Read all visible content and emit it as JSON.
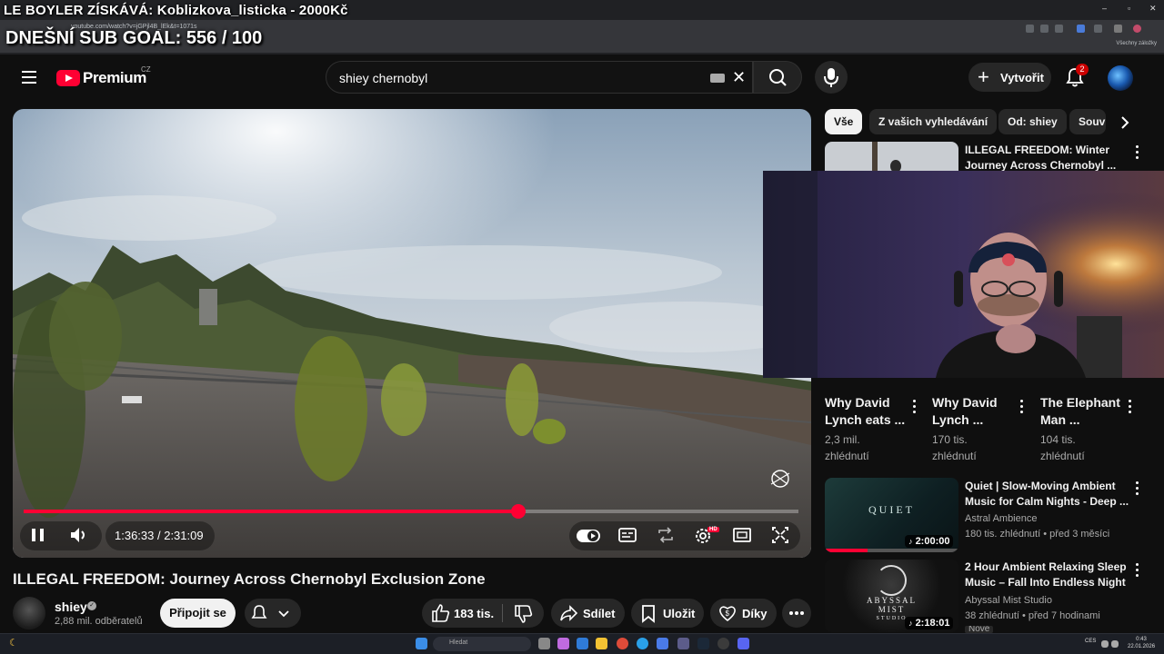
{
  "overlay": {
    "banner": "LE BOYLER ZÍSKÁVÁ: Koblizkova_listicka - 2000Kč",
    "goal": "DNEŠNÍ SUB GOAL: 556 / 100"
  },
  "browser": {
    "url": "youtube.com/watch?v=jGPjl4B_lEk&t=1071s",
    "bookmarks_label": "Všechny záložky",
    "window_controls": [
      "–",
      "▫",
      "✕"
    ]
  },
  "header": {
    "logo_text": "Premium",
    "country": "CZ",
    "search_query": "shiey chernobyl",
    "create_label": "Vytvořit",
    "notification_count": "2"
  },
  "player": {
    "current_time": "1:36:33",
    "separator": " / ",
    "duration": "2:31:09",
    "progress_fraction": 0.638,
    "hd_badge": "HD",
    "accent_color": "#ff0033"
  },
  "video": {
    "title": "ILLEGAL FREEDOM: Journey Across Chernobyl Exclusion Zone",
    "channel": "shiey",
    "verified_mark": "✓",
    "subscribers": "2,88 mil. odběratelů",
    "join_label": "Připojit se",
    "like_count": "183 tis.",
    "share_label": "Sdílet",
    "save_label": "Uložit",
    "thanks_label": "Díky"
  },
  "sidebar": {
    "chips": [
      "Vše",
      "Z vašich vyhledávání",
      "Od: shiey",
      "Souv"
    ],
    "top_video": {
      "title_line1": "ILLEGAL FREEDOM: Winter",
      "title_line2": "Journey Across Chernobyl ..."
    },
    "shorts": [
      {
        "title_line1": "Why David",
        "title_line2": "Lynch eats ...",
        "views_line1": "2,3 mil.",
        "views_line2": "zhlédnutí"
      },
      {
        "title_line1": "Why David",
        "title_line2": "Lynch ...",
        "views_line1": "170 tis.",
        "views_line2": "zhlédnutí"
      },
      {
        "title_line1": "The Elephant",
        "title_line2": "Man ...",
        "views_line1": "104 tis.",
        "views_line2": "zhlédnutí"
      }
    ],
    "videos": [
      {
        "title_line1": "Quiet | Slow-Moving Ambient",
        "title_line2": "Music for Calm Nights - Deep ...",
        "channel": "Astral Ambience",
        "meta": "180 tis. zhlédnutí • před 3 měsíci",
        "duration": "2:00:00",
        "thumb_text": "QUIET",
        "watched_fraction": 0.32
      },
      {
        "title_line1": "2 Hour Ambient Relaxing Sleep",
        "title_line2": "Music – Fall Into Endless Night",
        "channel": "Abyssal Mist Studio",
        "meta": "38 zhlédnutí • před 7 hodinami",
        "duration": "2:18:01",
        "thumb_text_1": "ABYSSAL",
        "thumb_text_2": "MIST",
        "thumb_text_3": "STUDIO",
        "badge": "Nové"
      }
    ]
  },
  "taskbar": {
    "search_placeholder": "Hledat",
    "lang": "CES",
    "time": "0:43",
    "date": "22.01.2026"
  }
}
